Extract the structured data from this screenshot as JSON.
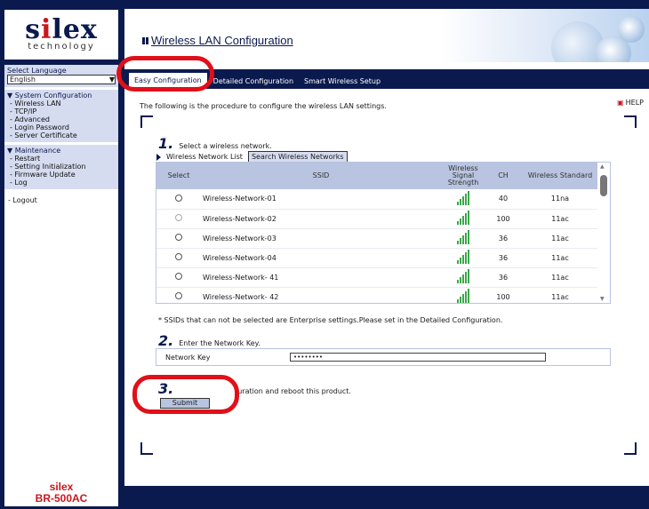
{
  "brand": {
    "logo_text_pre": "s",
    "logo_text_i": "i",
    "logo_text_post": "lex",
    "logo_sub": "technology",
    "vendor": "silex",
    "model": "BR-500AC"
  },
  "language": {
    "label": "Select Language",
    "value": "English"
  },
  "menu": {
    "system": {
      "head": "▼ System Configuration",
      "items": [
        "- Wireless LAN",
        "- TCP/IP",
        "- Advanced",
        "- Login Password",
        "- Server Certificate"
      ]
    },
    "maintenance": {
      "head": "▼ Maintenance",
      "items": [
        "- Restart",
        "- Setting Initialization",
        "- Firmware Update",
        "- Log"
      ]
    },
    "logout": "- Logout"
  },
  "header": {
    "title": "Wireless LAN Configuration"
  },
  "tabs": [
    {
      "label": "Easy Configuration",
      "active": true
    },
    {
      "label": "Detailed Configuration",
      "active": false
    },
    {
      "label": "Smart Wireless Setup",
      "active": false
    }
  ],
  "help": "HELP",
  "intro": "The following is the procedure to configure the wireless LAN settings.",
  "step1": {
    "num": "1.",
    "text": "Select a wireless network.",
    "list_label": "Wireless Network List",
    "search_btn": "Search Wireless Networks"
  },
  "table": {
    "headers": {
      "select": "Select",
      "ssid": "SSID",
      "signal": "Wireless Signal Strength",
      "ch": "CH",
      "std": "Wireless Standard"
    },
    "rows": [
      {
        "ssid": "Wireless-Network-01",
        "signal": 5,
        "ch": "40",
        "std": "11na",
        "enabled": true
      },
      {
        "ssid": "Wireless-Network-02",
        "signal": 5,
        "ch": "100",
        "std": "11ac",
        "enabled": false
      },
      {
        "ssid": "Wireless-Network-03",
        "signal": 5,
        "ch": "36",
        "std": "11ac",
        "enabled": true
      },
      {
        "ssid": "Wireless-Network-04",
        "signal": 5,
        "ch": "36",
        "std": "11ac",
        "enabled": true
      },
      {
        "ssid": "Wireless-Network- 41",
        "signal": 5,
        "ch": "36",
        "std": "11ac",
        "enabled": true
      },
      {
        "ssid": "Wireless-Network- 42",
        "signal": 5,
        "ch": "100",
        "std": "11ac",
        "enabled": true
      }
    ]
  },
  "note": "* SSIDs that can not be selected are Enterprise settings.Please set in the Detailed Configuration.",
  "step2": {
    "num": "2.",
    "text": "Enter the Network Key.",
    "label": "Network Key",
    "value": "••••••••"
  },
  "step3": {
    "num": "3.",
    "text": "uration and reboot this product.",
    "submit": "Submit"
  },
  "colors": {
    "navy": "#0b1a4e",
    "accent_red": "#e0101a",
    "signal_green": "#3aa64a",
    "panel": "#d6dcf0"
  }
}
